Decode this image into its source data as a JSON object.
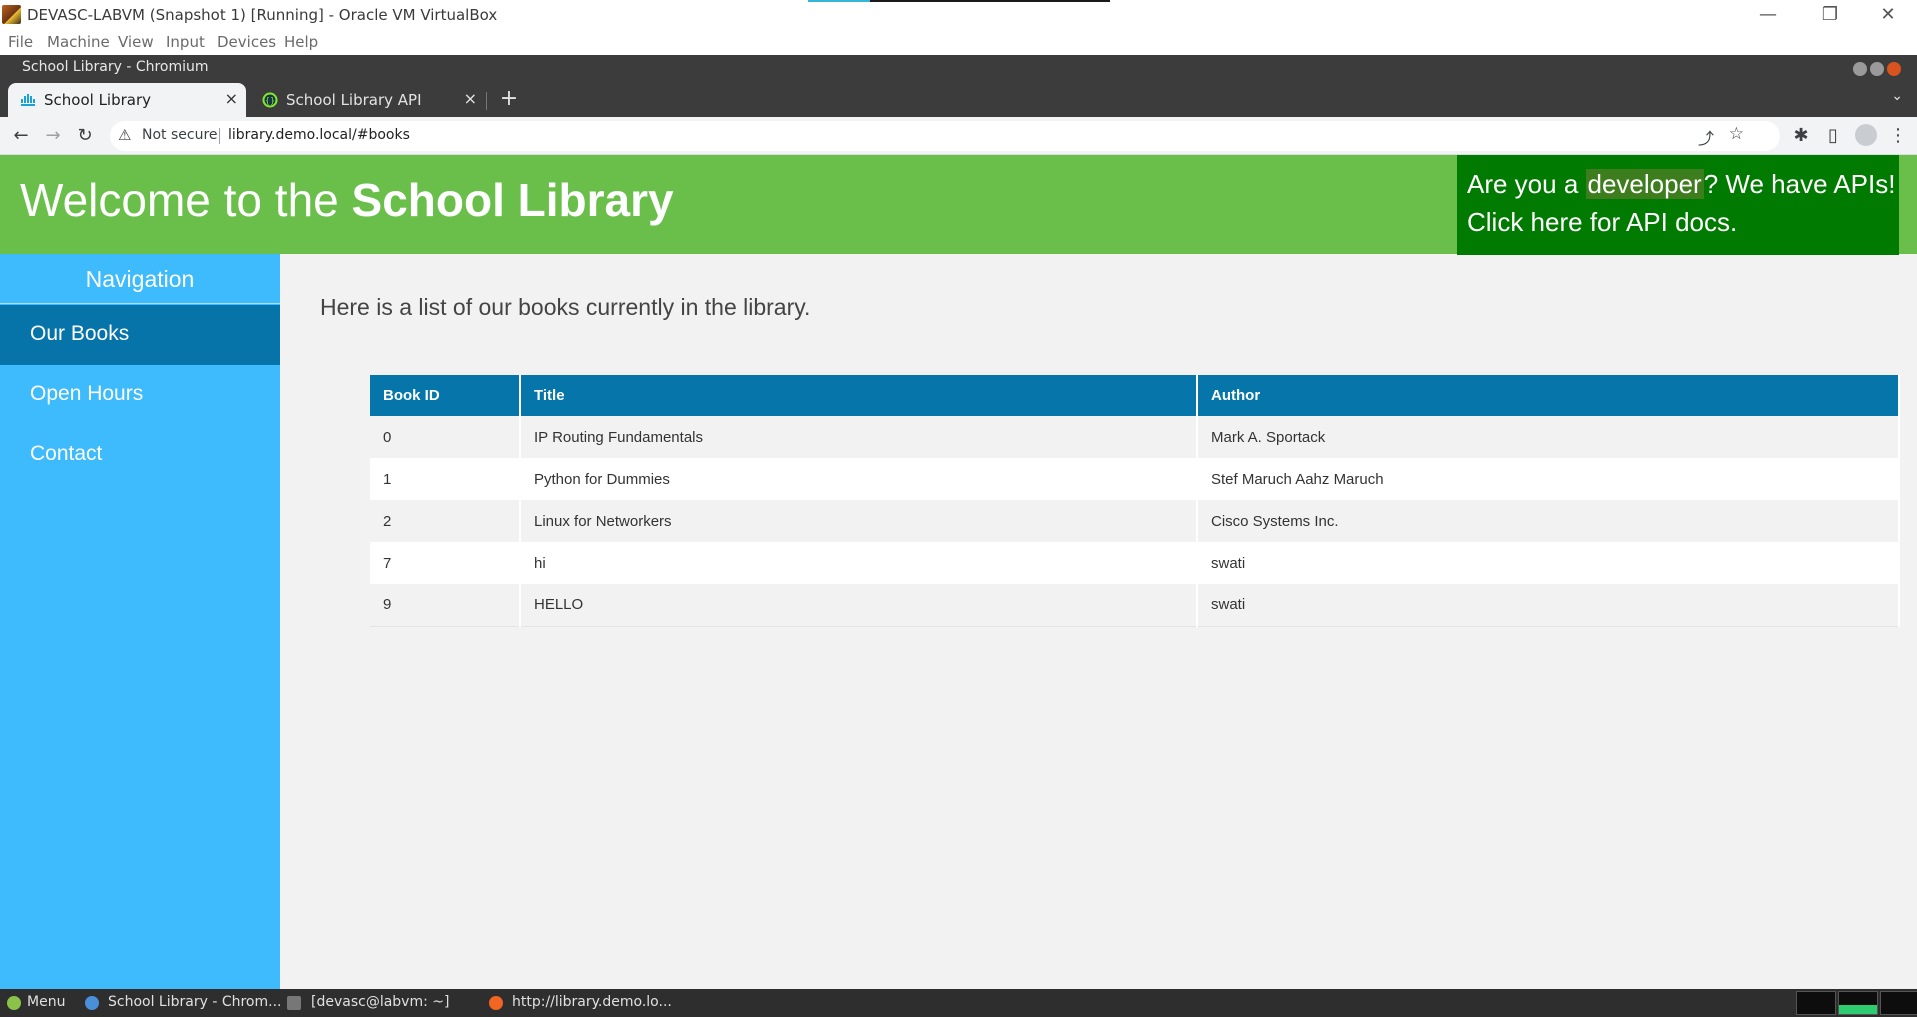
{
  "vbox": {
    "title": "DEVASC-LABVM (Snapshot 1) [Running] - Oracle VM VirtualBox",
    "menu": [
      "File",
      "Machine",
      "View",
      "Input",
      "Devices",
      "Help"
    ],
    "controls": {
      "minimize": "—",
      "restore": "❐",
      "close": "✕"
    }
  },
  "browser": {
    "window_title": "School Library - Chromium",
    "tabs": [
      {
        "label": "School Library",
        "active": true
      },
      {
        "label": "School Library API",
        "active": false
      }
    ],
    "tab_close": "×",
    "new_tab": "+",
    "tab_menu": "⌄",
    "nav": {
      "back": "←",
      "forward": "→",
      "reload": "↻"
    },
    "security_icon": "⚠",
    "security_label": "Not secure",
    "url": "library.demo.local/#books",
    "share": "⤴",
    "bookmark": "☆",
    "extensions": "✱",
    "sidepanel": "▯",
    "menu": "⋮"
  },
  "page": {
    "banner": {
      "prefix": "Welcome to the ",
      "bold": "School Library"
    },
    "api_promo": {
      "line1_pre": "Are you a ",
      "line1_highlight": "developer",
      "line1_post": "? We have APIs!",
      "line2": "Click here for API docs."
    },
    "nav": {
      "heading": "Navigation",
      "items": [
        {
          "label": "Our Books",
          "active": true
        },
        {
          "label": "Open Hours",
          "active": false
        },
        {
          "label": "Contact",
          "active": false
        }
      ]
    },
    "intro": "Here is a list of our books currently in the library.",
    "table": {
      "headers": [
        "Book ID",
        "Title",
        "Author"
      ],
      "rows": [
        [
          "0",
          "IP Routing Fundamentals",
          "Mark A. Sportack"
        ],
        [
          "1",
          "Python for Dummies",
          "Stef Maruch Aahz Maruch"
        ],
        [
          "2",
          "Linux for Networkers",
          "Cisco Systems Inc."
        ],
        [
          "7",
          "hi",
          "swati"
        ],
        [
          "9",
          "HELLO",
          "swati"
        ]
      ]
    }
  },
  "taskbar": {
    "menu": "Menu",
    "items": [
      "School Library - Chrom...",
      "[devasc@labvm: ~]",
      "http://library.demo.lo..."
    ]
  },
  "colors": {
    "banner_green": "#6abf4b",
    "api_green": "#007a00",
    "sidebar_blue": "#3dbbfc",
    "sidebar_active": "#0774a9",
    "table_header": "#0676aa"
  }
}
